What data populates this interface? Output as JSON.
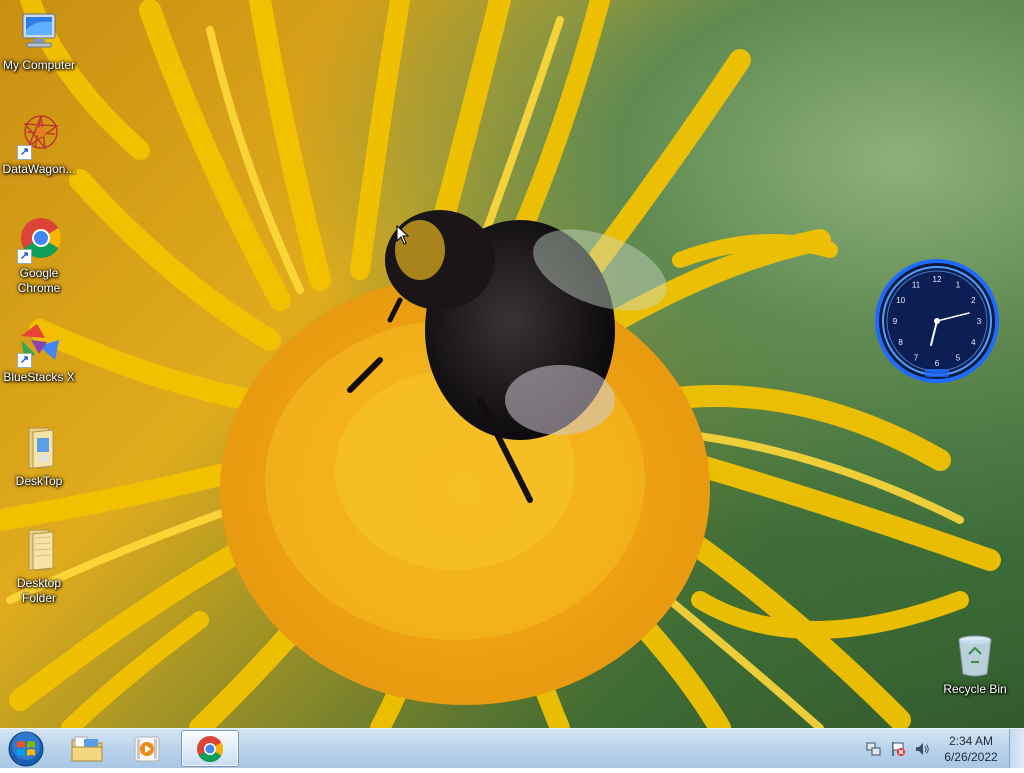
{
  "desktop": {
    "icons": [
      {
        "label": "My Computer",
        "icon": "my-computer-icon"
      },
      {
        "label": "DataWagon...",
        "icon": "datawagon-icon"
      },
      {
        "label": "Google\nChrome",
        "icon": "chrome-icon"
      },
      {
        "label": "BlueStacks X",
        "icon": "bluestacks-icon"
      },
      {
        "label": "DeskTop",
        "icon": "folder-icon"
      },
      {
        "label": "Desktop\nFolder",
        "icon": "folder-icon"
      },
      {
        "label": "Recycle Bin",
        "icon": "recycle-bin-icon"
      }
    ]
  },
  "gadget": {
    "clock_numerals": [
      "12",
      "1",
      "2",
      "3",
      "4",
      "5",
      "6",
      "7",
      "8",
      "9",
      "10",
      "11"
    ],
    "accent": "#1e6cff"
  },
  "taskbar": {
    "pinned": [
      {
        "name": "windows-explorer",
        "icon": "folder-icon"
      },
      {
        "name": "media-player",
        "icon": "media-player-icon"
      },
      {
        "name": "google-chrome",
        "icon": "chrome-icon",
        "active": true
      }
    ],
    "tray": {
      "icons": [
        "network-icon",
        "action-center-flag-icon",
        "volume-icon"
      ],
      "time": "2:34 AM",
      "date": "6/26/2022"
    }
  },
  "colors": {
    "taskbar_top": "#d5e5f4",
    "taskbar_bottom": "#a9c6e4",
    "wallpaper_petal": "#f5c400"
  }
}
